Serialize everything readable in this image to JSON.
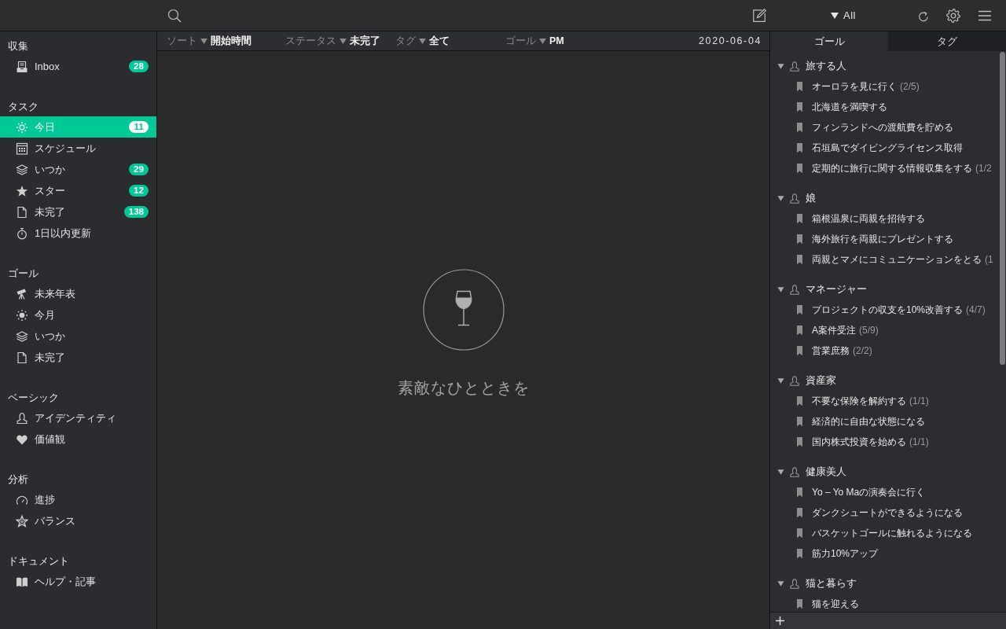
{
  "toolbar": {
    "view_filter": "All"
  },
  "sidebar": {
    "sections": [
      {
        "heading": "収集",
        "items": [
          {
            "label": "Inbox",
            "badge": "28",
            "selected": false
          }
        ]
      },
      {
        "heading": "タスク",
        "items": [
          {
            "label": "今日",
            "badge": "11",
            "selected": true
          },
          {
            "label": "スケジュール",
            "selected": false
          },
          {
            "label": "いつか",
            "badge": "29",
            "selected": false
          },
          {
            "label": "スター",
            "badge": "12",
            "selected": false
          },
          {
            "label": "未完了",
            "badge": "138",
            "selected": false
          },
          {
            "label": "1日以内更新",
            "selected": false
          }
        ]
      },
      {
        "heading": "ゴール",
        "items": [
          {
            "label": "未来年表",
            "selected": false
          },
          {
            "label": "今月",
            "selected": false
          },
          {
            "label": "いつか",
            "selected": false
          },
          {
            "label": "未完了",
            "selected": false
          }
        ]
      },
      {
        "heading": "ベーシック",
        "items": [
          {
            "label": "アイデンティティ",
            "selected": false
          },
          {
            "label": "価値観",
            "selected": false
          }
        ]
      },
      {
        "heading": "分析",
        "items": [
          {
            "label": "進捗",
            "selected": false
          },
          {
            "label": "バランス",
            "selected": false
          }
        ]
      },
      {
        "heading": "ドキュメント",
        "items": [
          {
            "label": "ヘルプ・記事",
            "selected": false
          }
        ]
      }
    ]
  },
  "filter_bar": {
    "filters": [
      {
        "label": "ソート",
        "value": "開始時間"
      },
      {
        "label": "ステータス",
        "value": "未完了"
      },
      {
        "label": "タグ",
        "value": "全て"
      },
      {
        "label": "ゴール",
        "value": "PM"
      }
    ],
    "date": "2020-06-04"
  },
  "empty_state": {
    "message": "素敵なひとときを"
  },
  "goal_panel": {
    "tabs": [
      {
        "label": "ゴール",
        "selected": true
      },
      {
        "label": "タグ",
        "selected": false
      }
    ],
    "groups": [
      {
        "name": "旅する人",
        "expanded": true,
        "children": [
          {
            "title": "オーロラを見に行く",
            "progress": "(2/5)"
          },
          {
            "title": "北海道を満喫する"
          },
          {
            "title": "フィンランドへの渡航費を貯める"
          },
          {
            "title": "石垣島でダイビングライセンス取得"
          },
          {
            "title": "定期的に旅行に関する情報収集をする",
            "progress": "(1/2"
          }
        ]
      },
      {
        "name": "娘",
        "expanded": true,
        "children": [
          {
            "title": "箱根温泉に両親を招待する"
          },
          {
            "title": "海外旅行を両親にプレゼントする"
          },
          {
            "title": "両親とマメにコミュニケーションをとる",
            "progress": "(1"
          }
        ]
      },
      {
        "name": "マネージャー",
        "expanded": true,
        "children": [
          {
            "title": "プロジェクトの収支を10%改善する",
            "progress": "(4/7)"
          },
          {
            "title": "A案件受注",
            "progress": "(5/9)"
          },
          {
            "title": "営業庶務",
            "progress": "(2/2)"
          }
        ]
      },
      {
        "name": "資産家",
        "expanded": true,
        "children": [
          {
            "title": "不要な保険を解約する",
            "progress": "(1/1)"
          },
          {
            "title": "経済的に自由な状態になる"
          },
          {
            "title": "国内株式投資を始める",
            "progress": "(1/1)"
          }
        ]
      },
      {
        "name": "健康美人",
        "expanded": true,
        "children": [
          {
            "title": "Yo – Yo Maの演奏会に行く"
          },
          {
            "title": "ダンクシュートができるようになる"
          },
          {
            "title": "バスケットゴールに触れるようになる"
          },
          {
            "title": "筋力10%アップ"
          }
        ]
      },
      {
        "name": "猫と暮らす",
        "expanded": true,
        "children": [
          {
            "title": "猫を迎える"
          }
        ]
      }
    ]
  }
}
